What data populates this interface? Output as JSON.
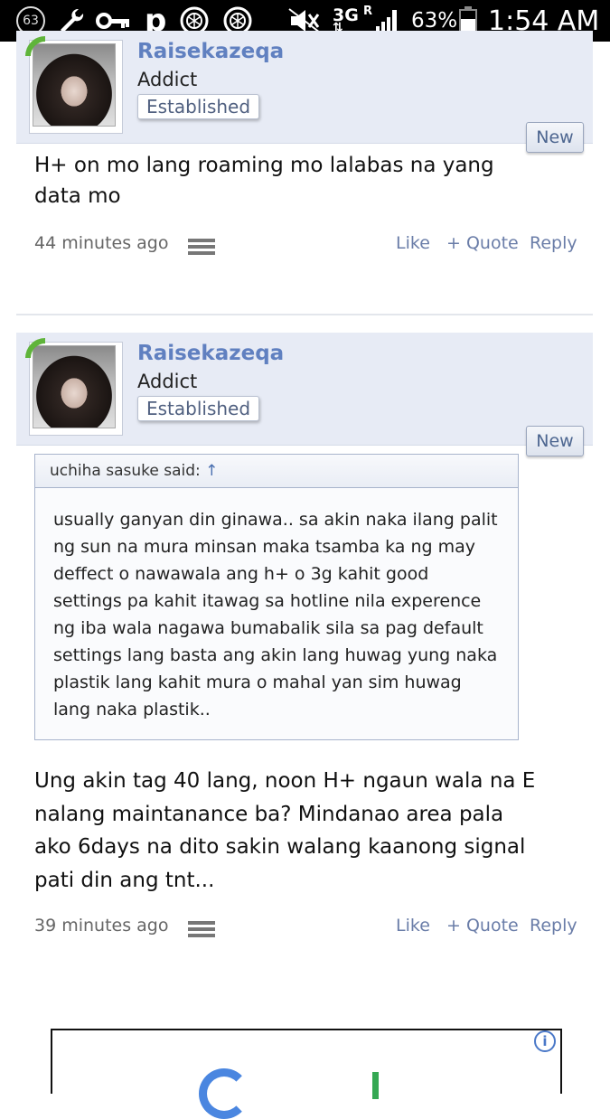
{
  "status_bar": {
    "notification_count": "63",
    "network": "3G",
    "roaming": "R",
    "battery": "63%",
    "time": "1:54 AM"
  },
  "posts": [
    {
      "username": "Raisekazeqa",
      "user_title": "Addict",
      "rank": "Established",
      "new_label": "New",
      "message": "H+ on mo lang roaming mo lalabas na yang data mo",
      "time": "44 minutes ago",
      "actions": {
        "like": "Like",
        "quote": "+ Quote",
        "reply": "Reply"
      }
    },
    {
      "username": "Raisekazeqa",
      "user_title": "Addict",
      "rank": "Established",
      "new_label": "New",
      "quote": {
        "header": "uchiha sasuke said:",
        "body": "usually ganyan din ginawa.. sa akin naka ilang palit ng sun na mura minsan maka tsamba ka ng may deffect o nawawala ang h+ o 3g kahit good settings pa kahit itawag sa hotline nila experence ng iba wala nagawa bumabalik sila sa pag default settings lang basta ang akin lang huwag yung naka plastik lang kahit mura o mahal yan sim huwag lang naka plastik.."
      },
      "message": "Ung akin tag 40 lang, noon H+ ngaun wala na E nalang maintanance ba? Mindanao area pala ako 6days na dito sakin walang kaanong signal pati din ang tnt...",
      "time": "39 minutes ago",
      "actions": {
        "like": "Like",
        "quote": "+ Quote",
        "reply": "Reply"
      }
    }
  ],
  "ad": {
    "info_icon": "i"
  },
  "icons": [
    "wrench-icon",
    "key-icon",
    "p-icon",
    "emblem-icon",
    "mute-icon",
    "signal-icon",
    "battery-icon",
    "menu-icon",
    "info-icon",
    "up-arrow-icon"
  ]
}
